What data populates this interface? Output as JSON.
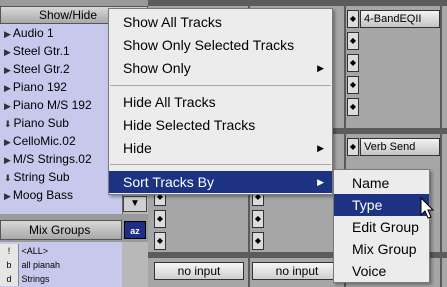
{
  "track_list": {
    "header": "Show/Hide",
    "tracks": [
      {
        "name": "Audio 1",
        "icon": "triangle"
      },
      {
        "name": "Steel Gtr.1",
        "icon": "triangle"
      },
      {
        "name": "Steel Gtr.2",
        "icon": "triangle"
      },
      {
        "name": "Piano 192",
        "icon": "triangle"
      },
      {
        "name": "Piano M/S 192",
        "icon": "triangle"
      },
      {
        "name": "Piano Sub",
        "icon": "down-arrow"
      },
      {
        "name": "CelloMic.02",
        "icon": "triangle"
      },
      {
        "name": "M/S Strings.02",
        "icon": "triangle"
      },
      {
        "name": "String Sub",
        "icon": "down-arrow"
      },
      {
        "name": "Moog Bass",
        "icon": "triangle"
      }
    ]
  },
  "mix_groups": {
    "header": "Mix Groups",
    "sort_button": "az",
    "rows": [
      {
        "key": "!",
        "name": "<ALL>"
      },
      {
        "key": "b",
        "name": "all pianah"
      },
      {
        "key": "d",
        "name": "Strings"
      }
    ]
  },
  "mixer": {
    "inserts": [
      "4-BandEQII"
    ],
    "sends": [
      "Verb Send"
    ],
    "inputs": [
      "no input",
      "no input"
    ]
  },
  "menu": {
    "items": [
      {
        "label": "Show All Tracks"
      },
      {
        "label": "Show Only Selected Tracks"
      },
      {
        "label": "Show Only",
        "submenu": true
      },
      {
        "label": "Hide All Tracks"
      },
      {
        "label": "Hide Selected Tracks"
      },
      {
        "label": "Hide",
        "submenu": true
      },
      {
        "label": "Sort Tracks By",
        "submenu": true,
        "highlighted": true
      }
    ]
  },
  "submenu": {
    "items": [
      {
        "label": "Name"
      },
      {
        "label": "Type",
        "highlighted": true
      },
      {
        "label": "Edit Group"
      },
      {
        "label": "Mix Group"
      },
      {
        "label": "Voice"
      }
    ]
  },
  "colors": {
    "highlight": "#1d3283",
    "track_list_bg": "#c8c8ec",
    "menu_bg": "#ececec"
  }
}
